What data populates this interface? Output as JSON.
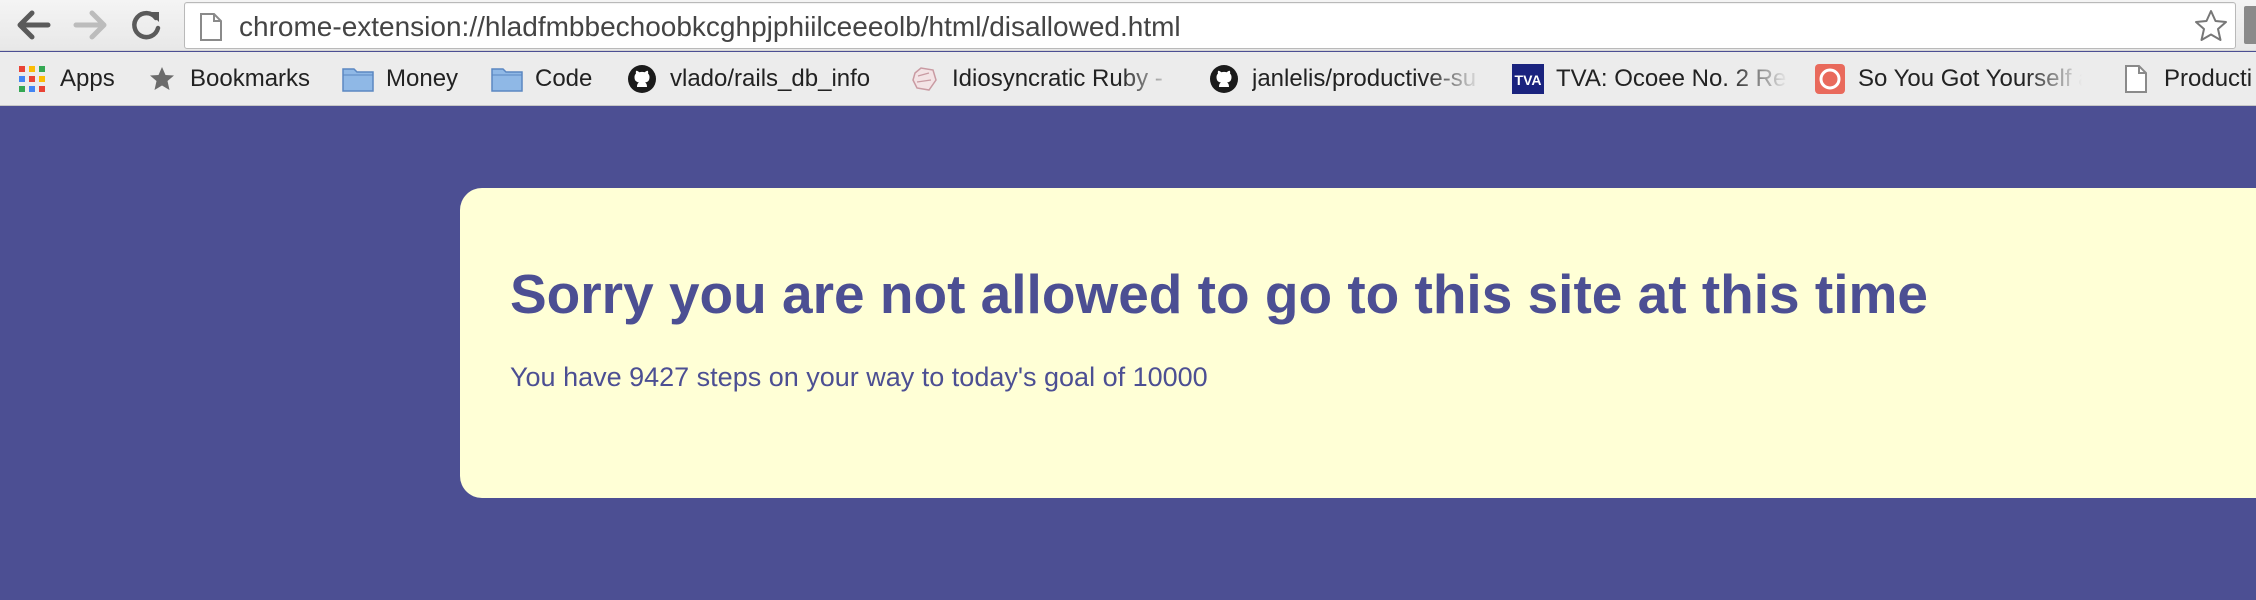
{
  "browser": {
    "url": "chrome-extension://hladfmbbechoobkcghpjphiilceeeolb/html/disallowed.html"
  },
  "bookmarks": [
    {
      "label": "Apps",
      "icon": "apps-grid-icon"
    },
    {
      "label": "Bookmarks",
      "icon": "star-icon"
    },
    {
      "label": "Money",
      "icon": "folder-icon"
    },
    {
      "label": "Code",
      "icon": "folder-icon"
    },
    {
      "label": "vlado/rails_db_info",
      "icon": "github-icon"
    },
    {
      "label": "Idiosyncratic Ruby -",
      "icon": "ruby-icon"
    },
    {
      "label": "janlelis/productive-su",
      "icon": "github-icon"
    },
    {
      "label": "TVA: Ocoee No. 2 Re",
      "icon": "tva-icon"
    },
    {
      "label": "So You Got Yourself a",
      "icon": "ring-icon"
    },
    {
      "label": "Producti",
      "icon": "page-icon"
    }
  ],
  "page": {
    "headline": "Sorry you are not allowed to go to this site at this time",
    "message": "You have 9427 steps on your way to today's goal of 10000"
  },
  "colors": {
    "background": "#4c4f93",
    "card": "#ffffd6",
    "text": "#4c4f93"
  }
}
